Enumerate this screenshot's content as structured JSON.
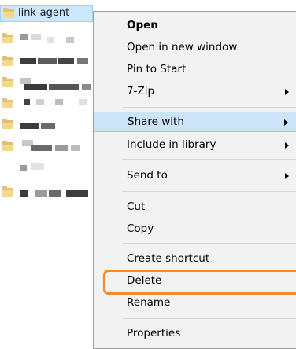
{
  "file_list": {
    "selected_name": "link-agent-",
    "selected_icon": "folder-icon",
    "folder_color": "#e6c06a"
  },
  "context_menu": {
    "items": [
      {
        "label": "Open",
        "bold": true
      },
      {
        "label": "Open in new window"
      },
      {
        "label": "Pin to Start"
      },
      {
        "label": "7-Zip",
        "submenu": true
      },
      {
        "label": "Share with",
        "submenu": true,
        "hovered": true
      },
      {
        "label": "Include in library",
        "submenu": true
      },
      {
        "label": "Send to",
        "submenu": true
      },
      {
        "label": "Cut"
      },
      {
        "label": "Copy"
      },
      {
        "label": "Create shortcut"
      },
      {
        "label": "Delete",
        "highlighted": true
      },
      {
        "label": "Rename"
      },
      {
        "label": "Properties"
      }
    ],
    "hover_color": "#cce4f7",
    "highlight_color": "#f08b2a"
  }
}
